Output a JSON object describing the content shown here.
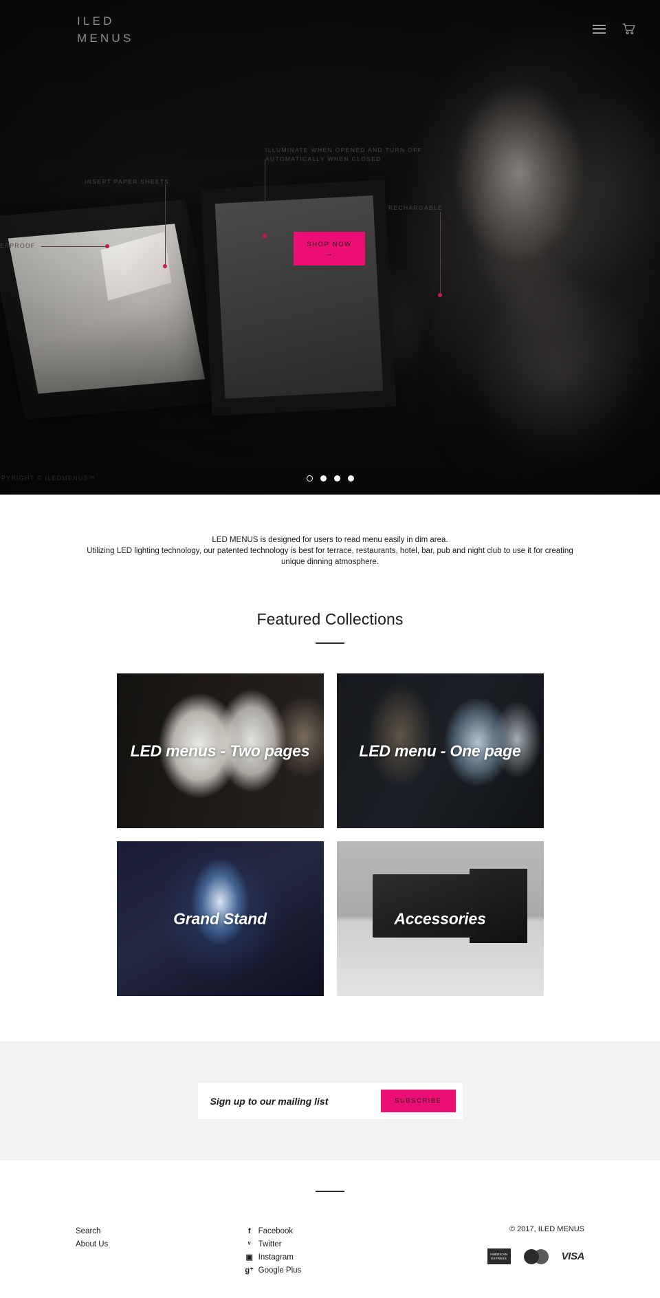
{
  "header": {
    "logo": "ILED\nMENUS",
    "menu_icon": "hamburger-icon",
    "cart_icon": "shopping-cart-icon"
  },
  "hero": {
    "annotations": [
      {
        "id": "illuminate",
        "text": "ILLUMINATE WHEN OPENED AND TURN OFF\nAUTOMATICALLY WHEN CLOSED"
      },
      {
        "id": "insert",
        "text": "INSERT PAPER SHEETS"
      },
      {
        "id": "rechargable",
        "text": "RECHARGABLE"
      },
      {
        "id": "waterproof",
        "text": "WATERPROOF"
      }
    ],
    "cta": {
      "label": "SHOP NOW",
      "arrow": "→",
      "bg": "#ec0f73",
      "fg": "#231f20"
    },
    "watermark": "COPYRIGHT © ILEDMENUS™",
    "carousel": {
      "slide_count": 4,
      "active_index": 0
    }
  },
  "intro": {
    "line1": "LED MENUS is designed for users to read menu easily in dim area.",
    "line2": "Utilizing LED lighting technology, our patented technology is best for terrace, restaurants, hotel, bar, pub and night club to use it for creating unique dinning atmosphere."
  },
  "featured": {
    "title": "Featured Collections",
    "cards": [
      {
        "title": "LED menus - Two pages",
        "art": "art-two-pages"
      },
      {
        "title": "LED menu - One page",
        "art": "art-one-page"
      },
      {
        "title": "Grand Stand",
        "art": "art-grand-stand"
      },
      {
        "title": "Accessories",
        "art": "art-accessories"
      }
    ]
  },
  "newsletter": {
    "placeholder": "Sign up to our mailing list",
    "value": "",
    "submit_label": "SUBSCRIBE",
    "accent": "#ec0f73"
  },
  "footer": {
    "links": [
      {
        "label": "Search"
      },
      {
        "label": "About Us"
      }
    ],
    "social": [
      {
        "icon": "facebook-icon",
        "glyph": "f",
        "label": "Facebook"
      },
      {
        "icon": "twitter-icon",
        "glyph": "ᵛ",
        "label": "Twitter"
      },
      {
        "icon": "instagram-icon",
        "glyph": "▣",
        "label": "Instagram"
      },
      {
        "icon": "google-plus-icon",
        "glyph": "g⁺",
        "label": "Google Plus"
      }
    ],
    "copyright": "© 2017, ILED MENUS",
    "payments": [
      {
        "name": "american-express",
        "line1": "AMERICAN",
        "line2": "EXPRESS"
      },
      {
        "name": "mastercard",
        "label": "MasterCard"
      },
      {
        "name": "visa",
        "label": "VISA"
      }
    ]
  }
}
